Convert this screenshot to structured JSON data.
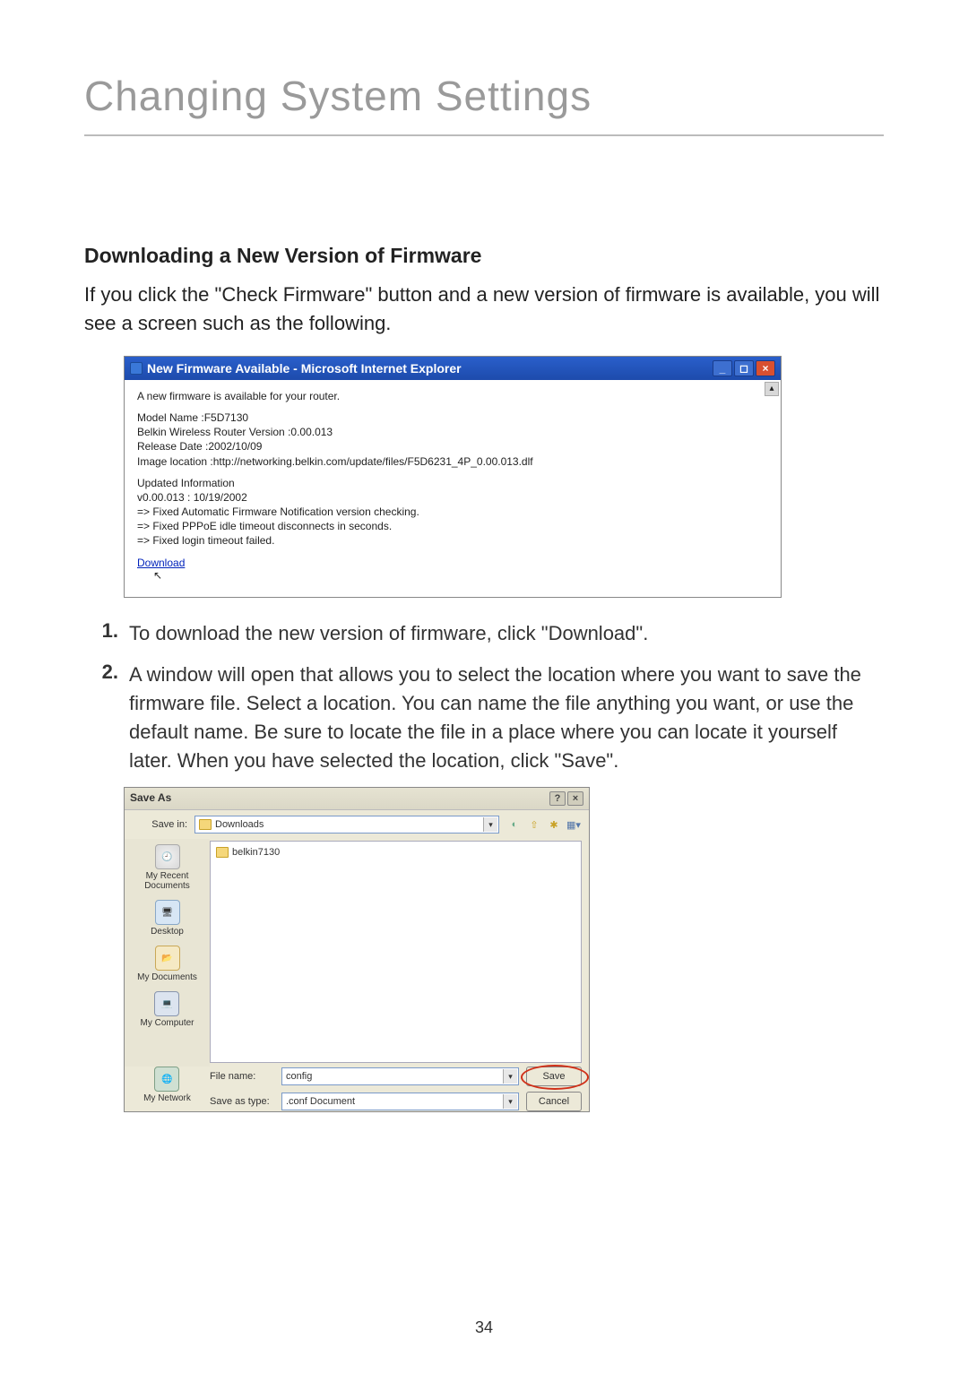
{
  "page": {
    "title": "Changing System Settings",
    "number": "34"
  },
  "section": {
    "heading": "Downloading a New Version of Firmware",
    "intro": "If you click the \"Check Firmware\" button and a new version of firmware is available, you will see a screen such as the following."
  },
  "ie_window": {
    "title": "New Firmware Available - Microsoft Internet Explorer",
    "notice": "A new firmware is available for your router.",
    "model_line": "Model Name :F5D7130",
    "version_line": "Belkin Wireless Router Version :0.00.013",
    "release_line": "Release Date :2002/10/09",
    "image_line": "Image location :http://networking.belkin.com/update/files/F5D6231_4P_0.00.013.dlf",
    "updated_heading": "Updated Information",
    "updated_v": "v0.00.013 : 10/19/2002",
    "fix1": "=> Fixed Automatic Firmware Notification version checking.",
    "fix2": "=> Fixed PPPoE idle timeout disconnects in seconds.",
    "fix3": "=> Fixed login timeout failed.",
    "download": "Download"
  },
  "steps": {
    "n1": "1.",
    "t1": "To download the new version of firmware, click \"Download\".",
    "n2": "2.",
    "t2": "A window will open that allows you to select the location where you want to save the firmware file. Select a location. You can name the file anything you want, or use the default name. Be sure to locate the file in a place where you can locate it yourself later. When you have selected the location, click \"Save\"."
  },
  "save_as": {
    "title": "Save As",
    "savein_label": "Save in:",
    "savein_value": "Downloads",
    "folder_item": "belkin7130",
    "side_recent": "My Recent Documents",
    "side_desktop": "Desktop",
    "side_mydocs": "My Documents",
    "side_mycomp": "My Computer",
    "side_mynet": "My Network",
    "filename_label": "File name:",
    "filename_value": "config",
    "savetype_label": "Save as type:",
    "savetype_value": ".conf Document",
    "save_btn": "Save",
    "cancel_btn": "Cancel"
  }
}
